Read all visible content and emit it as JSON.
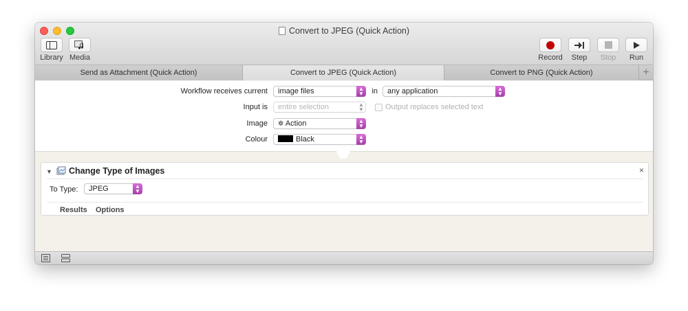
{
  "window": {
    "title": "Convert to JPEG (Quick Action)"
  },
  "toolbar": {
    "library_label": "Library",
    "media_label": "Media",
    "record_label": "Record",
    "step_label": "Step",
    "stop_label": "Stop",
    "run_label": "Run"
  },
  "tabs": [
    {
      "label": "Send as Attachment (Quick Action)"
    },
    {
      "label": "Convert to JPEG (Quick Action)"
    },
    {
      "label": "Convert to PNG (Quick Action)"
    }
  ],
  "tab_add_label": "+",
  "workflow": {
    "receives_label": "Workflow receives current",
    "receives_value": "image files",
    "in_label": "in",
    "app_value": "any application",
    "input_label": "Input is",
    "input_value": "entire selection",
    "output_replaces_label": "Output replaces selected text",
    "image_label": "Image",
    "image_value": "Action",
    "colour_label": "Colour",
    "colour_value": "Black",
    "colour_swatch": "#000000"
  },
  "action": {
    "title": "Change Type of Images",
    "to_type_label": "To Type:",
    "to_type_value": "JPEG",
    "results_tab": "Results",
    "options_tab": "Options",
    "close_glyph": "×"
  },
  "colors": {
    "accent_popup": "#b54bb8",
    "record_red": "#c00000"
  }
}
